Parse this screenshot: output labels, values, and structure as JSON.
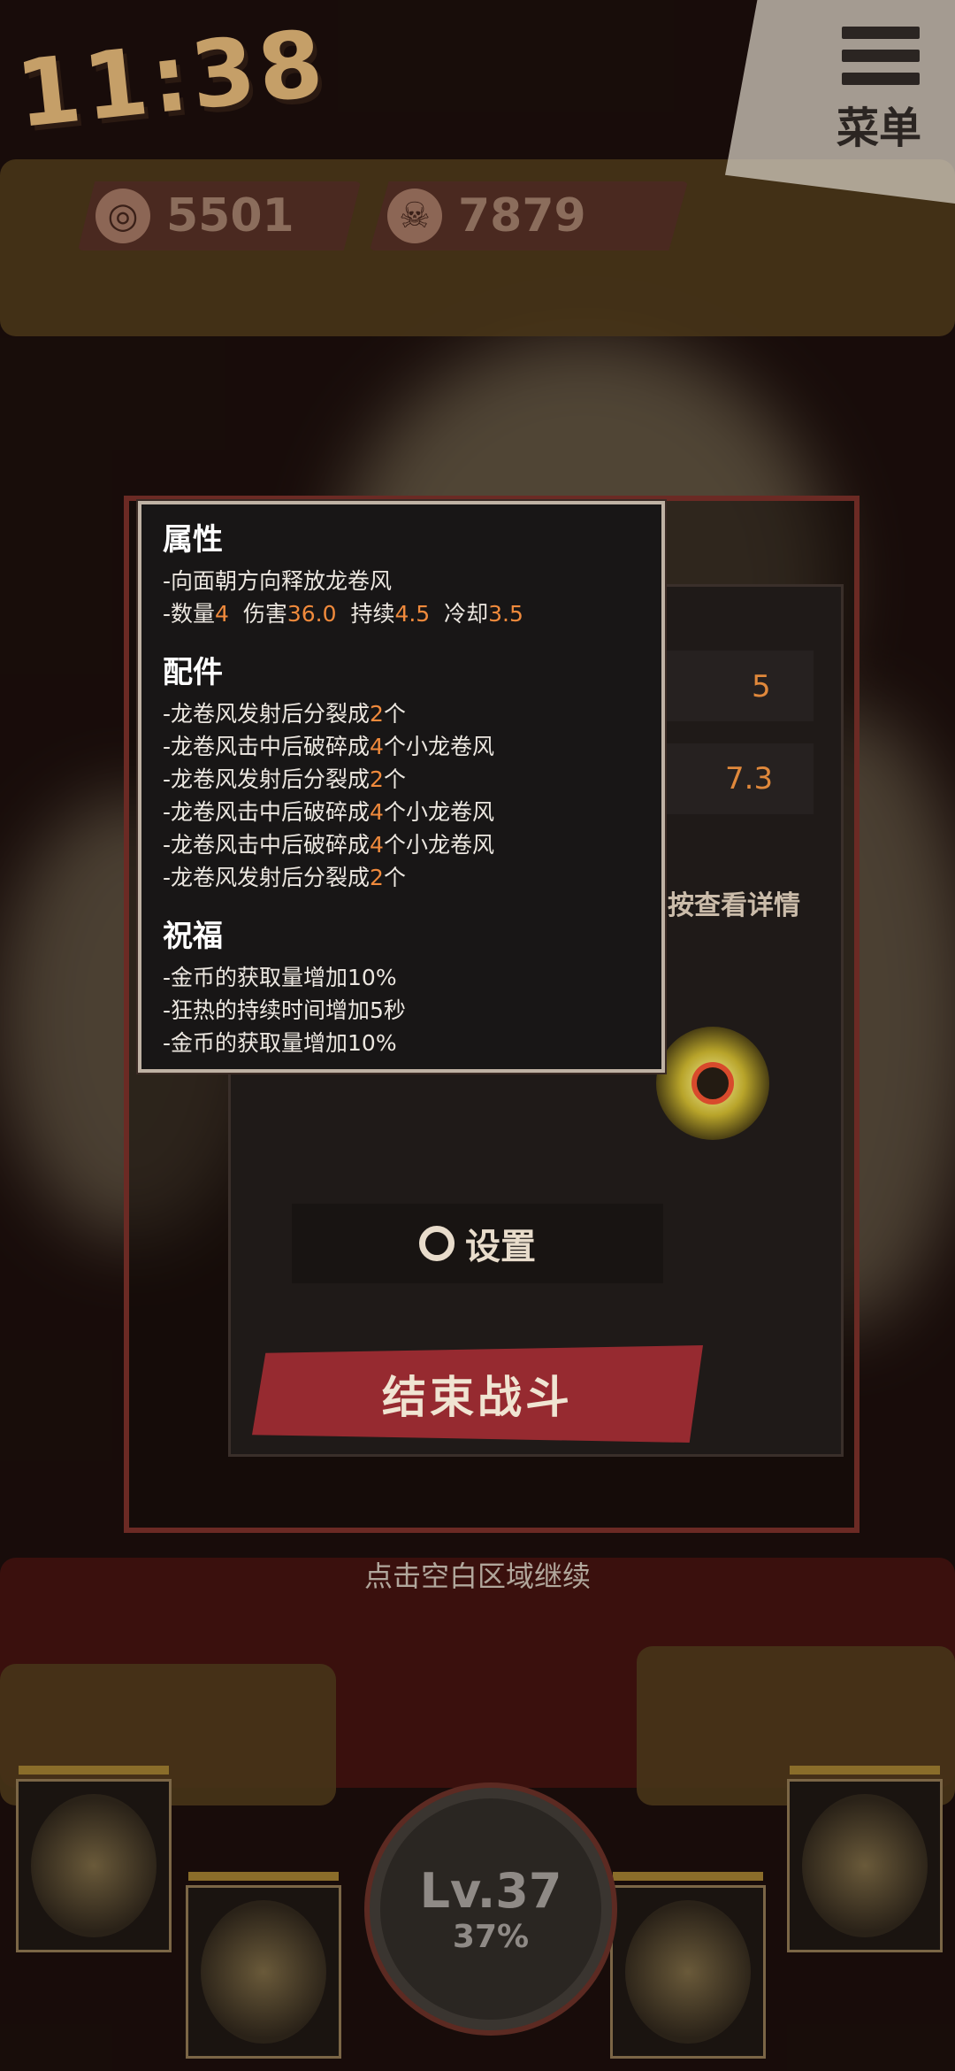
{
  "hud": {
    "clock": "11:38",
    "menu_label": "菜单",
    "coins": "5501",
    "kills": "7879"
  },
  "tooltip": {
    "attributes": {
      "heading": "属性",
      "desc": "-向面朝方向释放龙卷风",
      "stats": [
        {
          "label": "-数量",
          "value": "4"
        },
        {
          "label": "伤害",
          "value": "36.0"
        },
        {
          "label": "持续",
          "value": "4.5"
        },
        {
          "label": "冷却",
          "value": "3.5"
        }
      ]
    },
    "parts": {
      "heading": "配件",
      "items": [
        {
          "pre": "-龙卷风发射后分裂成",
          "num": "2",
          "post": "个"
        },
        {
          "pre": "-龙卷风击中后破碎成",
          "num": "4",
          "post": "个小龙卷风"
        },
        {
          "pre": "-龙卷风发射后分裂成",
          "num": "2",
          "post": "个"
        },
        {
          "pre": "-龙卷风击中后破碎成",
          "num": "4",
          "post": "个小龙卷风"
        },
        {
          "pre": "-龙卷风击中后破碎成",
          "num": "4",
          "post": "个小龙卷风"
        },
        {
          "pre": "-龙卷风发射后分裂成",
          "num": "2",
          "post": "个"
        }
      ]
    },
    "blessings": {
      "heading": "祝福",
      "items": [
        "-金币的获取量增加10%",
        "-狂热的持续时间增加5秒",
        "-金币的获取量增加10%"
      ]
    }
  },
  "panel": {
    "stat_value_1": "5",
    "stat_value_2": "7.3",
    "detail_hint": "按查看详情",
    "settings_label": "设置",
    "end_battle_label": "结束战斗"
  },
  "continue_hint": "点击空白区域继续",
  "player": {
    "level": "Lv.37",
    "progress": "37%"
  }
}
